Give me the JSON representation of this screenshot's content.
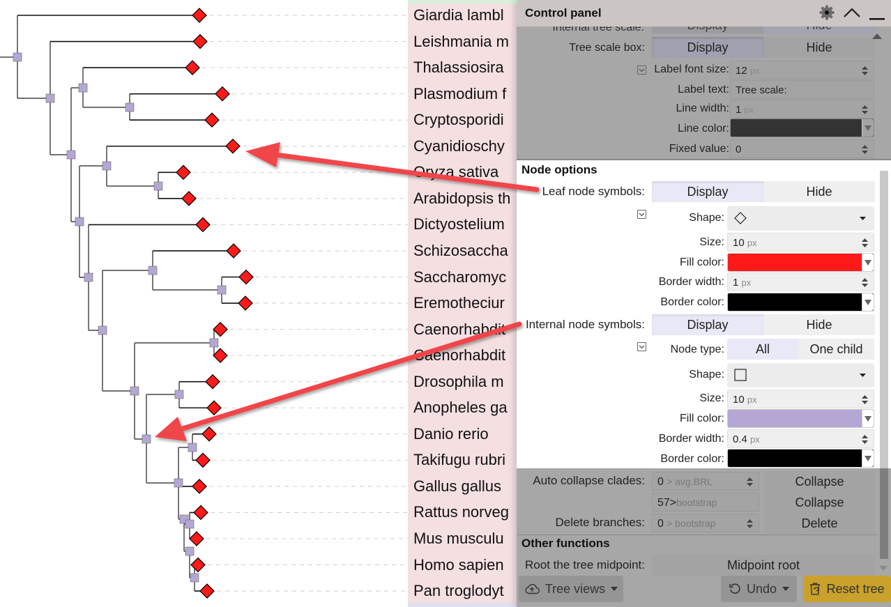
{
  "tree": {
    "leaf_fill": "#ff1a1a",
    "leaf_border": "#000000",
    "internal_fill": "#b5a7d4",
    "internal_border": "#666666",
    "leaves": [
      "Giardia lamblia",
      "Leishmania major",
      "Thalassiosira pseudonana",
      "Plasmodium falciparum",
      "Cryptosporidium hominis",
      "Cyanidioschyzon merolae",
      "Oryza sativa",
      "Arabidopsis thaliana",
      "Dictyostelium discoideum",
      "Schizosaccharomyces pombe",
      "Saccharomyces cerevisiae",
      "Eremothecium gossypii",
      "Caenorhabditis elegans",
      "Caenorhabditis briggsae",
      "Drosophila melanogaster",
      "Anopheles gambiae",
      "Danio rerio",
      "Takifugu rubripes",
      "Gallus gallus",
      "Rattus norvegicus",
      "Mus musculus",
      "Homo sapiens",
      "Pan troglodytes"
    ],
    "leaf_labels_visible": [
      "Giardia lambl",
      "Leishmania m",
      "Thalassiosira",
      "Plasmodium f",
      "Cryptosporidi",
      "Cyanidioschy",
      "Oryza sativa",
      "Arabidopsis th",
      "Dictyostelium",
      "Schizosaccha",
      "Saccharomyc",
      "Eremotheciur",
      "Caenorhabdit",
      "Caenorhabdit",
      "Drosophila m",
      "Anopheles ga",
      "Danio rerio",
      "Takifugu rubri",
      "Gallus gallus",
      "Rattus norveg",
      "Mus musculu",
      "Homo sapien",
      "Pan troglodyt"
    ]
  },
  "annotation_arrows": [
    {
      "name": "arrow-to-leaf-node",
      "color": "#f04448"
    },
    {
      "name": "arrow-to-internal-node",
      "color": "#f04448"
    }
  ],
  "panel": {
    "title": "Control panel",
    "icons": [
      "gear-icon",
      "chevron-up-icon",
      "minimize-icon"
    ],
    "tree_scale": {
      "internal_label": "Internal tree scale:",
      "internal_display": "Display",
      "internal_hide": "Hide",
      "box_label": "Tree scale box:",
      "display": "Display",
      "hide": "Hide",
      "font_size_label": "Label font size:",
      "font_size_value": "12",
      "font_size_unit": "px",
      "label_text_label": "Label text:",
      "label_text_value": "Tree scale:",
      "line_width_label": "Line width:",
      "line_width_value": "1",
      "line_width_unit": "px",
      "line_color_label": "Line color:",
      "line_color_value": "#333333",
      "fixed_value_label": "Fixed value:",
      "fixed_value_value": "0"
    },
    "node_options": {
      "title": "Node options",
      "leaf": {
        "label": "Leaf node symbols:",
        "display": "Display",
        "hide": "Hide",
        "shape_label": "Shape:",
        "shape_value": "diamond",
        "size_label": "Size:",
        "size_value": "10",
        "size_unit": "px",
        "fill_label": "Fill color:",
        "fill_value": "#ff1a1a",
        "border_width_label": "Border width:",
        "border_width_value": "1",
        "border_width_unit": "px",
        "border_color_label": "Border color:",
        "border_color_value": "#000000"
      },
      "internal": {
        "label": "Internal node symbols:",
        "display": "Display",
        "hide": "Hide",
        "node_type_label": "Node type:",
        "node_type_all": "All",
        "node_type_one_child": "One child",
        "shape_label": "Shape:",
        "shape_value": "square",
        "size_label": "Size:",
        "size_value": "10",
        "size_unit": "px",
        "fill_label": "Fill color:",
        "fill_value": "#b5a7d4",
        "border_width_label": "Border width:",
        "border_width_value": "0.4",
        "border_width_unit": "px",
        "border_color_label": "Border color:",
        "border_color_value": "#000000"
      }
    },
    "collapse": {
      "auto_label": "Auto collapse clades:",
      "auto_value": "0",
      "auto_hint": "> avg.BRL",
      "auto_button": "Collapse",
      "bootstrap_value": "57>",
      "bootstrap_hint": "bootstrap",
      "bootstrap_button": "Collapse",
      "delete_label": "Delete branches:",
      "delete_value": "0",
      "delete_hint": "> bootstrap",
      "delete_button": "Delete"
    },
    "other": {
      "title": "Other functions",
      "midpoint_label": "Root the tree midpoint:",
      "midpoint_button": "Midpoint root"
    },
    "footer": {
      "tree_views": "Tree views",
      "undo": "Undo",
      "reset": "Reset tree"
    }
  }
}
